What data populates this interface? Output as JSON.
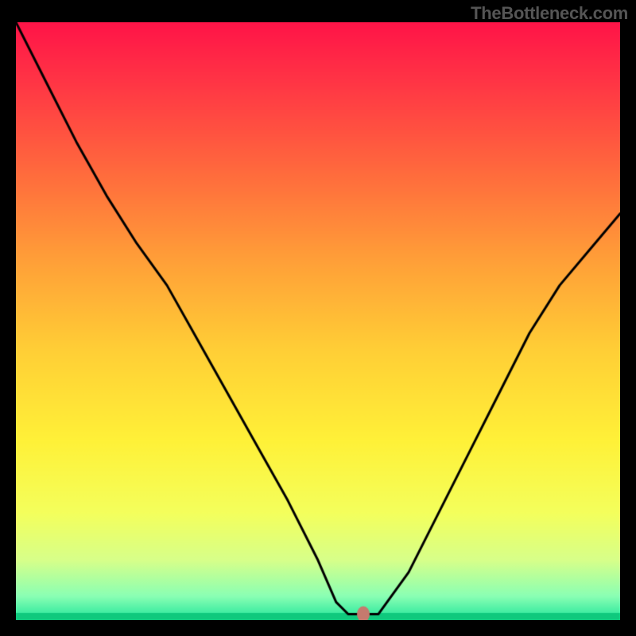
{
  "watermark": "TheBottleneck.com",
  "chart_data": {
    "type": "line",
    "title": "",
    "xlabel": "",
    "ylabel": "",
    "xlim": [
      0,
      100
    ],
    "ylim": [
      0,
      100
    ],
    "legend": null,
    "annotations": [],
    "series": [
      {
        "name": "bottleneck-curve",
        "color": "#000000",
        "x": [
          0,
          5,
          10,
          15,
          20,
          25,
          30,
          35,
          40,
          45,
          50,
          53,
          55,
          57,
          60,
          65,
          70,
          75,
          80,
          85,
          90,
          95,
          100
        ],
        "y": [
          100,
          90,
          80,
          71,
          63,
          56,
          47,
          38,
          29,
          20,
          10,
          3,
          1,
          1,
          1,
          8,
          18,
          28,
          38,
          48,
          56,
          62,
          68
        ]
      }
    ],
    "marker": {
      "x": 57.5,
      "y": 1,
      "color": "#c57a6e"
    },
    "background_gradient": {
      "stops": [
        {
          "pos": 0.0,
          "color": "#ff1448"
        },
        {
          "pos": 0.1,
          "color": "#ff3545"
        },
        {
          "pos": 0.25,
          "color": "#ff6a3d"
        },
        {
          "pos": 0.4,
          "color": "#ffa038"
        },
        {
          "pos": 0.55,
          "color": "#ffcf36"
        },
        {
          "pos": 0.7,
          "color": "#fff138"
        },
        {
          "pos": 0.82,
          "color": "#f4ff5c"
        },
        {
          "pos": 0.9,
          "color": "#d7ff8a"
        },
        {
          "pos": 0.96,
          "color": "#8affb4"
        },
        {
          "pos": 1.0,
          "color": "#20e59a"
        }
      ]
    },
    "bottom_band": {
      "y_from": 0,
      "y_to": 1.2,
      "color": "#0fc97d"
    }
  }
}
